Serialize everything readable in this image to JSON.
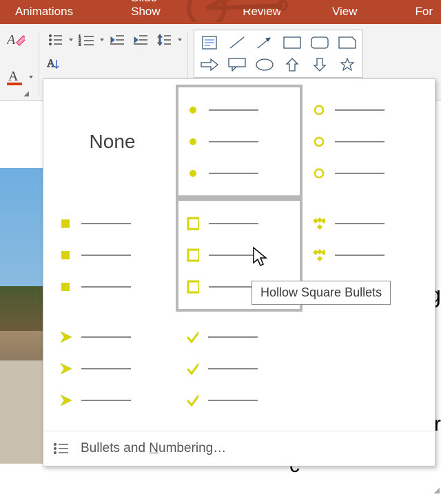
{
  "ribbon": {
    "tabs": [
      "Animations",
      "Slide Show",
      "Review",
      "View",
      "For"
    ]
  },
  "dropdown": {
    "none_label": "None",
    "tooltip": "Hollow Square Bullets",
    "footer_prefix": "Bullets and ",
    "footer_accel": "N",
    "footer_suffix": "umbering…",
    "cells": [
      {
        "kind": "none"
      },
      {
        "kind": "filled-circle",
        "selected": true
      },
      {
        "kind": "hollow-circle"
      },
      {
        "kind": "filled-square"
      },
      {
        "kind": "hollow-square",
        "hovered": true
      },
      {
        "kind": "four-diamond"
      },
      {
        "kind": "arrowhead"
      },
      {
        "kind": "checkmark"
      },
      {
        "kind": "blank"
      }
    ]
  },
  "colors": {
    "accent": "#d6d40a",
    "ribbon": "#b7472a"
  },
  "obscured": {
    "r1": "g",
    "r2": "r",
    "r3": "c"
  }
}
